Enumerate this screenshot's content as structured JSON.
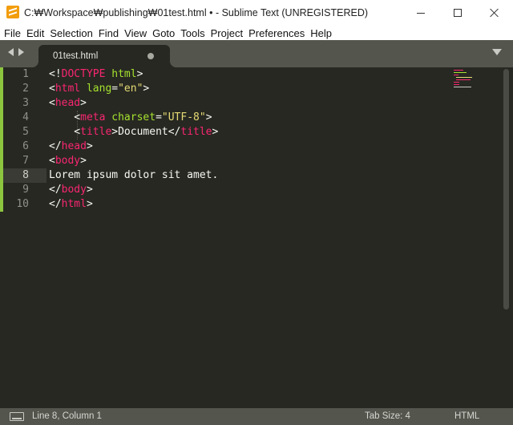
{
  "window": {
    "title": "C:₩Workspace₩publishing₩01test.html • - Sublime Text (UNREGISTERED)",
    "app_icon": "sublime-text-logo"
  },
  "menu": [
    {
      "label": "File"
    },
    {
      "label": "Edit"
    },
    {
      "label": "Selection"
    },
    {
      "label": "Find"
    },
    {
      "label": "View"
    },
    {
      "label": "Goto"
    },
    {
      "label": "Tools"
    },
    {
      "label": "Project"
    },
    {
      "label": "Preferences"
    },
    {
      "label": "Help"
    }
  ],
  "tabs": [
    {
      "label": "01test.html",
      "modified": true,
      "active": true
    }
  ],
  "editor": {
    "current_line": 8,
    "line_numbers": [
      "1",
      "2",
      "3",
      "4",
      "5",
      "6",
      "7",
      "8",
      "9",
      "10"
    ],
    "lines": [
      [
        {
          "t": "<!",
          "c": "punct"
        },
        {
          "t": "DOCTYPE",
          "c": "tag"
        },
        {
          "t": " html",
          "c": "attr"
        },
        {
          "t": ">",
          "c": "punct"
        }
      ],
      [
        {
          "t": "<",
          "c": "punct"
        },
        {
          "t": "html",
          "c": "tag"
        },
        {
          "t": " lang",
          "c": "attr"
        },
        {
          "t": "=",
          "c": "punct"
        },
        {
          "t": "\"en\"",
          "c": "str"
        },
        {
          "t": ">",
          "c": "punct"
        }
      ],
      [
        {
          "t": "<",
          "c": "punct"
        },
        {
          "t": "head",
          "c": "tag"
        },
        {
          "t": ">",
          "c": "punct"
        }
      ],
      [
        {
          "t": "    <",
          "c": "punct"
        },
        {
          "t": "meta",
          "c": "tag"
        },
        {
          "t": " charset",
          "c": "attr"
        },
        {
          "t": "=",
          "c": "punct"
        },
        {
          "t": "\"UTF-8\"",
          "c": "str"
        },
        {
          "t": ">",
          "c": "punct"
        }
      ],
      [
        {
          "t": "    <",
          "c": "punct"
        },
        {
          "t": "title",
          "c": "tag"
        },
        {
          "t": ">Document</",
          "c": "punct"
        },
        {
          "t": "title",
          "c": "tag"
        },
        {
          "t": ">",
          "c": "punct"
        }
      ],
      [
        {
          "t": "</",
          "c": "punct"
        },
        {
          "t": "head",
          "c": "tag"
        },
        {
          "t": ">",
          "c": "punct"
        }
      ],
      [
        {
          "t": "<",
          "c": "punct"
        },
        {
          "t": "body",
          "c": "tag"
        },
        {
          "t": ">",
          "c": "punct"
        }
      ],
      [
        {
          "t": "Lorem ipsum dolor sit amet.",
          "c": "punct"
        }
      ],
      [
        {
          "t": "</",
          "c": "punct"
        },
        {
          "t": "body",
          "c": "tag"
        },
        {
          "t": ">",
          "c": "punct"
        }
      ],
      [
        {
          "t": "</",
          "c": "punct"
        },
        {
          "t": "html",
          "c": "tag"
        },
        {
          "t": ">",
          "c": "punct"
        }
      ]
    ]
  },
  "status": {
    "position": "Line 8, Column 1",
    "tab_size": "Tab Size: 4",
    "syntax": "HTML"
  },
  "colors": {
    "editor_bg": "#272822",
    "tag": "#f92672",
    "attr": "#a6e22e",
    "string": "#e6db74",
    "text": "#f8f8f2",
    "gutter_modified": "#8cc63f",
    "chrome": "#54564e"
  }
}
